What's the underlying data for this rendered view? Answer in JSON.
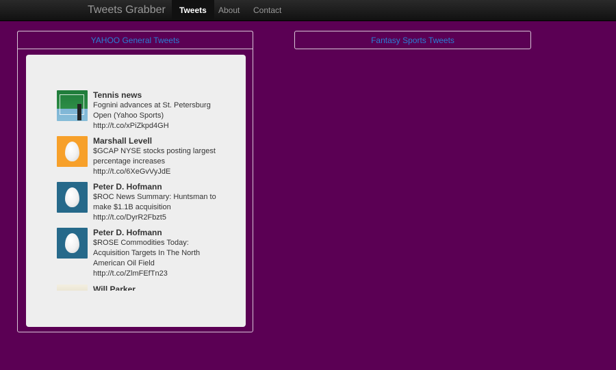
{
  "navbar": {
    "brand": "Tweets Grabber",
    "items": [
      {
        "label": "Tweets",
        "active": true
      },
      {
        "label": "About",
        "active": false
      },
      {
        "label": "Contact",
        "active": false
      }
    ]
  },
  "panels": {
    "yahoo": {
      "title": "YAHOO General Tweets"
    },
    "fantasy": {
      "title": "Fantasy Sports Tweets"
    }
  },
  "tweets": [
    {
      "author": "Tennis news",
      "text": "Fognini advances at St. Petersburg Open (Yahoo Sports)",
      "link": "http://t.co/xPiZkpd4GH",
      "avatar": "tennis-court-photo"
    },
    {
      "author": "Marshall Levell",
      "text": "$GCAP NYSE stocks posting largest percentage increases",
      "link": "http://t.co/6XeGvVyJdE",
      "avatar": "default-egg-orange"
    },
    {
      "author": "Peter D. Hofmann",
      "text": "$ROC News Summary: Huntsman to make $1.1B acquisition",
      "link": "http://t.co/DyrR2Fbzt5",
      "avatar": "default-egg-teal"
    },
    {
      "author": "Peter D. Hofmann",
      "text": "$ROSE Commodities Today: Acquisition Targets In The North American Oil Field",
      "link": "http://t.co/ZlmFEfTn23",
      "avatar": "default-egg-teal"
    },
    {
      "author": "Will Parker",
      "text": "",
      "link": "",
      "avatar": "photo"
    }
  ],
  "colors": {
    "background": "#5b0054",
    "link": "#2a7fd3",
    "card": "#eeeeee"
  }
}
